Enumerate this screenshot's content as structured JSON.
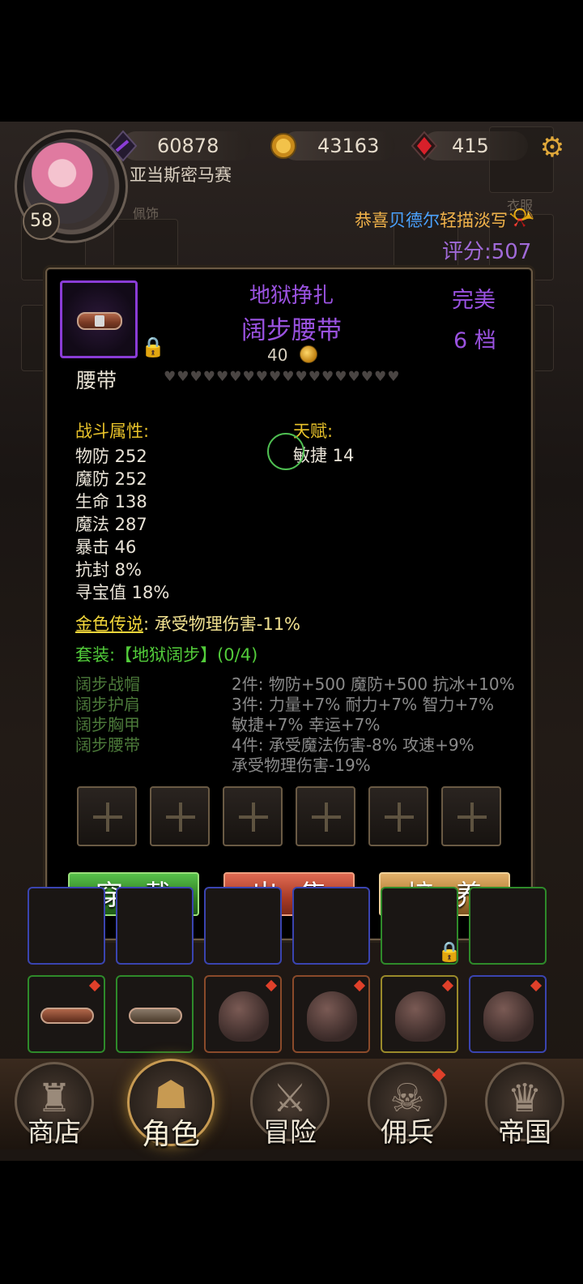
{
  "header": {
    "player_name": "亚当斯密马赛",
    "level": "58",
    "crystal": "60878",
    "gold": "43163",
    "gems": "415",
    "faint_labels": [
      "佩饰",
      "衣服"
    ],
    "marquee": {
      "prefix": "恭喜",
      "name": "贝德尔",
      "suffix": "轻描淡写"
    },
    "score": "评分:507"
  },
  "item": {
    "set_name": "地狱挣扎",
    "name": "阔步腰带",
    "required_level": "40",
    "quality": "完美",
    "grade": "6 档",
    "slot": "腰带",
    "hearts_count": 18,
    "combat_title": "战斗属性:",
    "stats": [
      "物防 252",
      "魔防 252",
      "生命 138",
      "魔法 287",
      "暴击 46",
      "抗封 8%",
      "寻宝值 18%"
    ],
    "talent_title": "天赋:",
    "talent": "敏捷 14",
    "legend_title": "金色传说",
    "legend_text": ":  承受物理伤害-11%",
    "suit_title": "套装:【地狱阔步】(0/4)",
    "suit_pieces": [
      "阔步战帽",
      "阔步护肩",
      "阔步胸甲",
      "阔步腰带"
    ],
    "suit_bonuses": [
      "2件:  物防+500 魔防+500 抗冰+10%",
      "3件:  力量+7% 耐力+7% 智力+7%",
      "敏捷+7% 幸运+7%",
      "4件:  承受魔法伤害-8% 攻速+9%",
      "承受物理伤害-19%"
    ]
  },
  "actions": {
    "wear": "穿戴",
    "sell": "出售",
    "train": "培养"
  },
  "inventory_bottom_row": [
    {
      "kind": "belt",
      "border": "#2e8a2a",
      "dot": true
    },
    {
      "kind": "belt",
      "border": "#2e8a2a",
      "dot": false
    },
    {
      "kind": "hat",
      "border": "#8a4a2a",
      "dot": true
    },
    {
      "kind": "hat",
      "border": "#8a4a2a",
      "dot": true
    },
    {
      "kind": "hat",
      "border": "#9a8a2a",
      "dot": true
    },
    {
      "kind": "hat",
      "border": "#3a44b0",
      "dot": true
    }
  ],
  "nav": [
    {
      "label": "商店",
      "icon": "castle-icon"
    },
    {
      "label": "角色",
      "icon": "hood-icon"
    },
    {
      "label": "冒险",
      "icon": "crossed-swords-icon"
    },
    {
      "label": "佣兵",
      "icon": "mercenary-icon"
    },
    {
      "label": "帝国",
      "icon": "crown-icon"
    }
  ],
  "colors": {
    "accent_purple": "#9a52e0",
    "gold_text": "#e8c22a",
    "suit_green": "#52cc3a"
  }
}
